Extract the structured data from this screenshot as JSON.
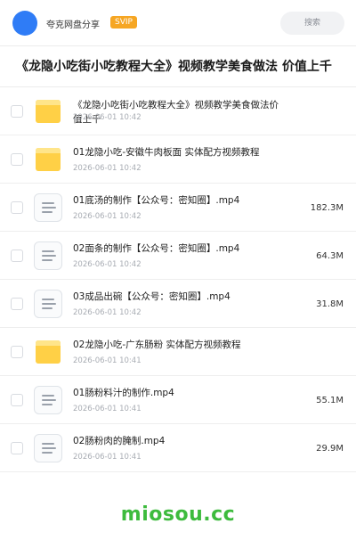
{
  "header": {
    "brand": "夸克网盘分享",
    "badge": "SVIP",
    "search_label": "搜索"
  },
  "folder_title": "《龙隐小吃街小吃教程大全》视频教学美食做法 价值上千",
  "items": [
    {
      "type": "folder",
      "name": "《龙隐小吃街小吃教程大全》视频教学美食做法价值上千",
      "date": "2026-06-01 10:42",
      "size": ""
    },
    {
      "type": "folder",
      "name": "01龙隐小吃-安徽牛肉板面 实体配方视频教程",
      "date": "2026-06-01 10:42",
      "size": ""
    },
    {
      "type": "file",
      "name": "01底汤的制作【公众号：密知圈】.mp4",
      "date": "2026-06-01 10:42",
      "size": "182.3M"
    },
    {
      "type": "file",
      "name": "02面条的制作【公众号：密知圈】.mp4",
      "date": "2026-06-01 10:42",
      "size": "64.3M"
    },
    {
      "type": "file",
      "name": "03成品出碗【公众号：密知圈】.mp4",
      "date": "2026-06-01 10:42",
      "size": "31.8M"
    },
    {
      "type": "folder",
      "name": "02龙隐小吃-广东肠粉 实体配方视频教程",
      "date": "2026-06-01 10:41",
      "size": ""
    },
    {
      "type": "file",
      "name": "01肠粉料汁的制作.mp4",
      "date": "2026-06-01 10:41",
      "size": "55.1M"
    },
    {
      "type": "file",
      "name": "02肠粉肉的腌制.mp4",
      "date": "2026-06-01 10:41",
      "size": "29.9M"
    }
  ],
  "watermark": "miosou.cc",
  "colors": {
    "avatar": "#2f7cf6",
    "svip_badge": "#f6a623",
    "folder": "#ffd046",
    "watermark": "#3dbb3d"
  }
}
